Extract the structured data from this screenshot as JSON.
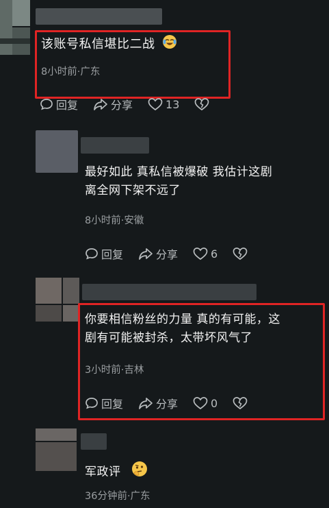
{
  "comments": [
    {
      "text": "该账号私信堪比二战",
      "emoji": "crying-laughing-emoji",
      "meta": "8小时前·广东",
      "reply": "回复",
      "share": "分享",
      "likes": "13"
    },
    {
      "text_line1": "最好如此 真私信被爆破 我估计这剧",
      "text_line2": "离全网下架不远了",
      "meta": "8小时前·安徽",
      "reply": "回复",
      "share": "分享",
      "likes": "6"
    },
    {
      "text_line1": "你要相信粉丝的力量 真的有可能，这",
      "text_line2": "剧有可能被封杀，太带坏风气了",
      "meta": "3小时前·吉林",
      "reply": "回复",
      "share": "分享",
      "likes": "0"
    },
    {
      "text": "军政评",
      "emoji": "thinking-emoji",
      "meta": "36分钟前·广东"
    }
  ],
  "colors": {
    "background": "#15191b",
    "highlight": "#e02424",
    "meta_text": "#9a9ea1"
  }
}
